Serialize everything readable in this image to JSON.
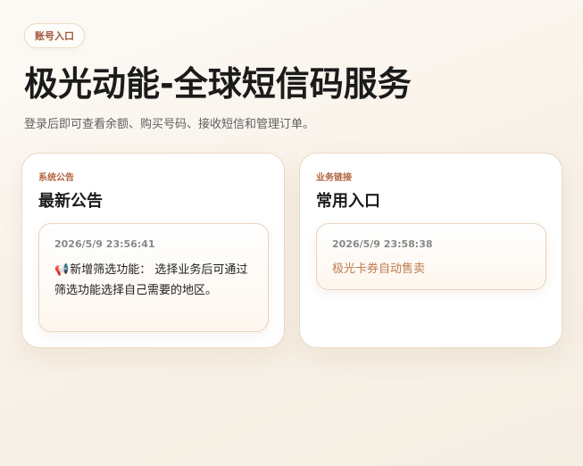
{
  "header": {
    "badge_label": "账号入口",
    "title": "极光动能-全球短信码服务",
    "subtitle": "登录后即可查看余额、购买号码、接收短信和管理订单。"
  },
  "announcement_card": {
    "eyebrow": "系统公告",
    "title": "最新公告",
    "notice": {
      "timestamp": "2026/5/9 23:56:41",
      "icon": "megaphone-icon",
      "icon_glyph": "📢",
      "text": "新增筛选功能： 选择业务后可通过筛选功能选择自己需要的地区。"
    }
  },
  "links_card": {
    "eyebrow": "业务链接",
    "title": "常用入口",
    "entry": {
      "timestamp": "2026/5/9 23:58:38",
      "link_label": "极光卡券自动售卖"
    }
  },
  "colors": {
    "accent": "#b0643f",
    "link": "#c07a4e",
    "border": "#ead9c7",
    "background": "#f8f1e7"
  }
}
